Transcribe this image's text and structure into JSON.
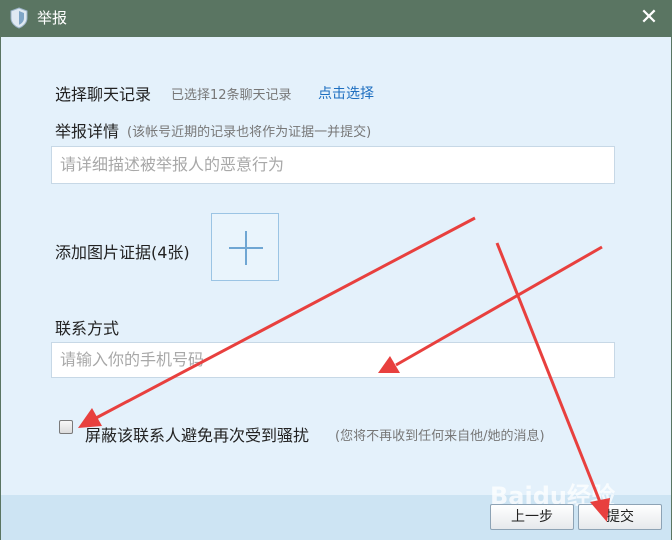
{
  "window": {
    "title": "举报",
    "close_glyph": "✕",
    "title_icon": "shield-icon"
  },
  "chat_record": {
    "label": "选择聊天记录",
    "status": "已选择12条聊天记录",
    "select_link": "点击选择"
  },
  "report_details": {
    "label": "举报详情",
    "note": "(该帐号近期的记录也将作为证据一并提交)",
    "placeholder": "请详细描述被举报人的恶意行为"
  },
  "image_evidence": {
    "label": "添加图片证据(4张)",
    "add_icon": "plus-icon"
  },
  "contact": {
    "label": "联系方式",
    "placeholder": "请输入你的手机号码"
  },
  "block_option": {
    "checked": false,
    "label": "屏蔽该联系人避免再次受到骚扰",
    "note": "(您将不再收到任何来自他/她的消息)"
  },
  "buttons": {
    "previous": "上一步",
    "submit": "提交"
  },
  "watermark": {
    "text": "Baidu经验"
  },
  "colors": {
    "titlebar": "#5a7562",
    "background": "#e4f1fb",
    "link": "#1e6fc0",
    "arrow": "#e8403e"
  }
}
